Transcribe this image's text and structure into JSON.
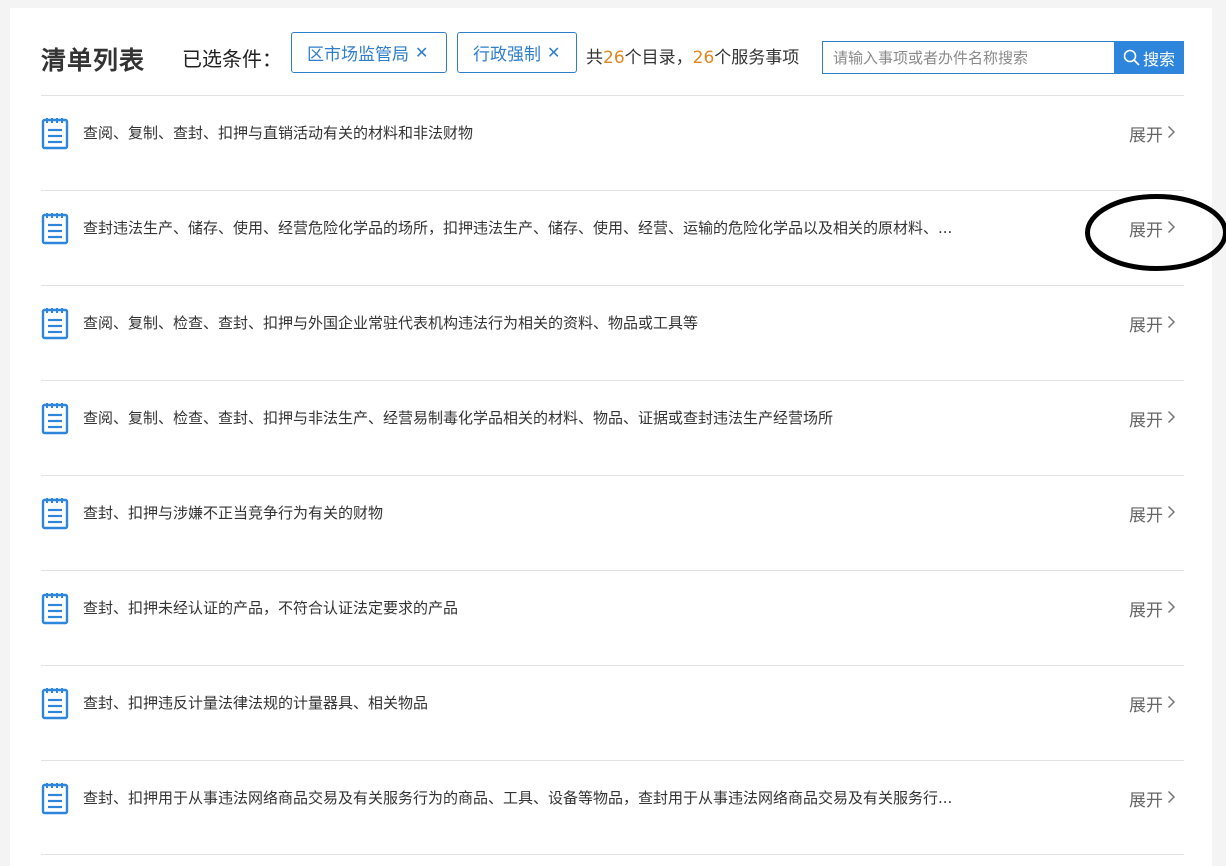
{
  "header": {
    "title": "清单列表",
    "conditions_label": "已选条件：",
    "chips": [
      {
        "label": "区市场监管局"
      },
      {
        "label": "行政强制"
      }
    ],
    "summary": {
      "prefix": "共",
      "catalog_count": "26",
      "catalog_suffix": "个目录，",
      "service_count": "26",
      "service_suffix": "个服务事项"
    },
    "search": {
      "placeholder": "请输入事项或者办件名称搜索",
      "value": "",
      "button_label": "搜索"
    }
  },
  "items": [
    {
      "title": "查阅、复制、查封、扣押与直销活动有关的材料和非法财物",
      "expand_label": "展开"
    },
    {
      "title": "查封违法生产、储存、使用、经营危险化学品的场所，扣押违法生产、储存、使用、经营、运输的危险化学品以及相关的原材料、...",
      "expand_label": "展开"
    },
    {
      "title": "查阅、复制、检查、查封、扣押与外国企业常驻代表机构违法行为相关的资料、物品或工具等",
      "expand_label": "展开"
    },
    {
      "title": "查阅、复制、检查、查封、扣押与非法生产、经营易制毒化学品相关的材料、物品、证据或查封违法生产经营场所",
      "expand_label": "展开"
    },
    {
      "title": "查封、扣押与涉嫌不正当竞争行为有关的财物",
      "expand_label": "展开"
    },
    {
      "title": "查封、扣押未经认证的产品，不符合认证法定要求的产品",
      "expand_label": "展开"
    },
    {
      "title": "查封、扣押违反计量法律法规的计量器具、相关物品",
      "expand_label": "展开"
    },
    {
      "title": "查封、扣押用于从事违法网络商品交易及有关服务行为的商品、工具、设备等物品，查封用于从事违法网络商品交易及有关服务行...",
      "expand_label": "展开"
    }
  ],
  "colors": {
    "accent": "#2d85dc",
    "count_highlight": "#e3861f"
  },
  "icons": {
    "chip_remove": "close-icon",
    "search": "search-icon",
    "item": "document-icon",
    "expand": "chevron-right-icon"
  }
}
